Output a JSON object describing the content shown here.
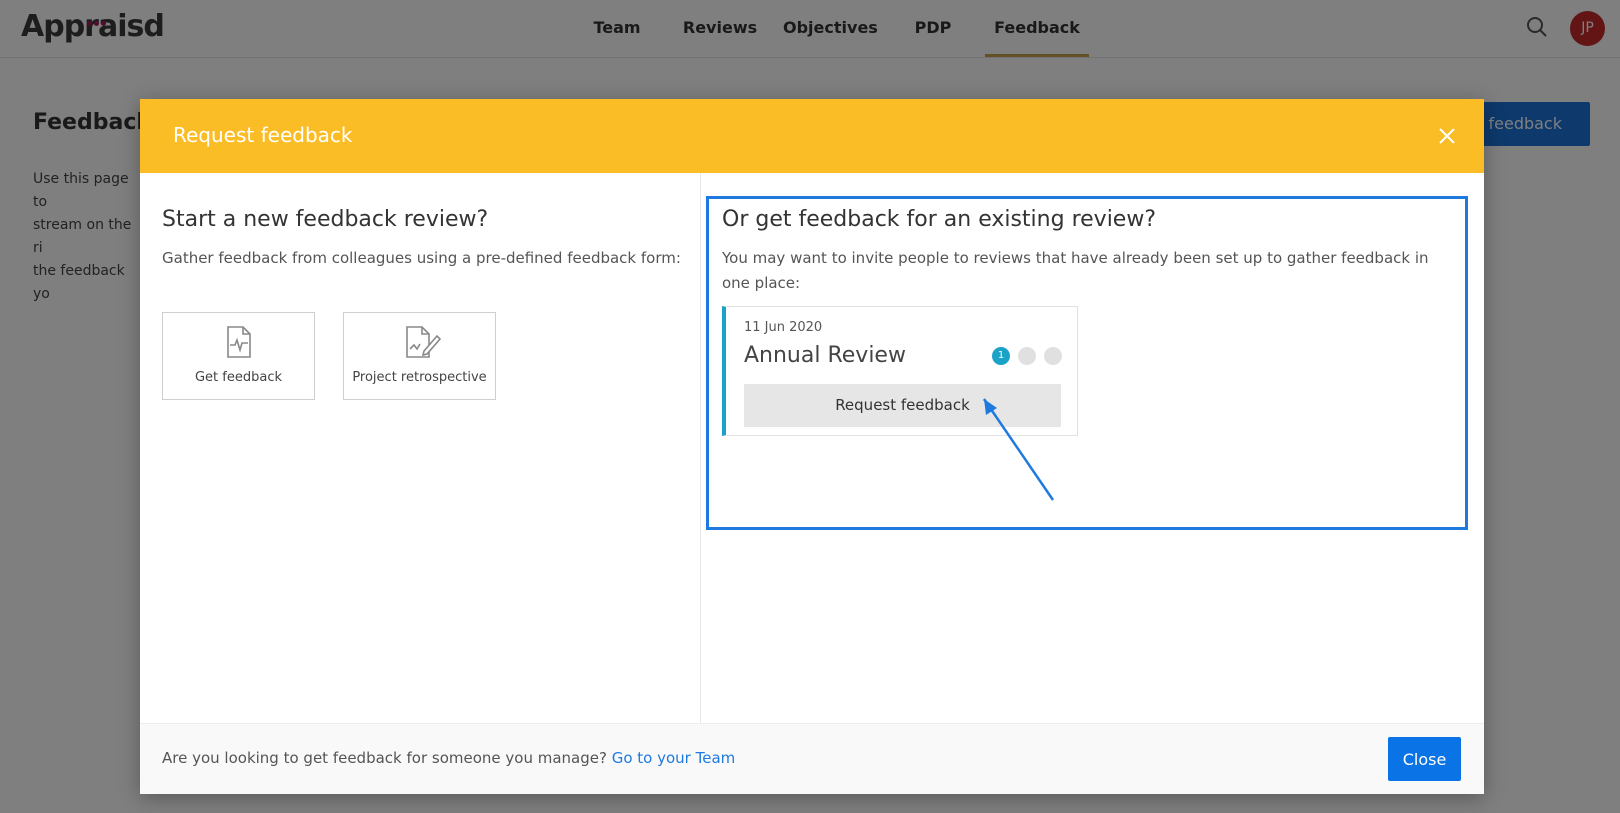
{
  "app": {
    "logo_text": "Appraisd",
    "brand_color": "#a11d5c"
  },
  "nav": {
    "items": [
      {
        "label": "Team"
      },
      {
        "label": "Reviews"
      },
      {
        "label": "Objectives"
      },
      {
        "label": "PDP"
      },
      {
        "label": "Feedback",
        "active": true
      }
    ],
    "search_icon": "search-icon",
    "avatar_initials": "JP",
    "active_underline_color": "#c9a04a"
  },
  "background_page": {
    "title": "Feedback",
    "description": "Use this page to\nstream on the ri\nthe feedback yo",
    "action_label": "est feedback"
  },
  "modal": {
    "title": "Request feedback",
    "header_color": "#fbbd26",
    "close_icon": "close-icon",
    "new_review": {
      "heading": "Start a new feedback review?",
      "subtitle": "Gather feedback from colleagues using a pre-defined feedback form:",
      "tiles": [
        {
          "label": "Get feedback",
          "icon": "document-pulse-icon"
        },
        {
          "label": "Project retrospective",
          "icon": "document-pen-icon"
        }
      ]
    },
    "existing_review": {
      "heading": "Or get feedback for an existing review?",
      "subtitle": "You may want to invite people to reviews that have already been set up to gather feedback in one place:",
      "highlight_color": "#1f7ae0",
      "card": {
        "date": "11 Jun 2020",
        "title": "Annual Review",
        "steps": [
          {
            "label": "1",
            "active": true
          },
          {
            "label": "",
            "active": false
          },
          {
            "label": "",
            "active": false
          }
        ],
        "button_label": "Request feedback",
        "accent_color": "#1ba2c9"
      }
    },
    "footer": {
      "text": "Are you looking to get feedback for someone you manage?",
      "link_label": "Go to your Team",
      "close_label": "Close"
    }
  }
}
